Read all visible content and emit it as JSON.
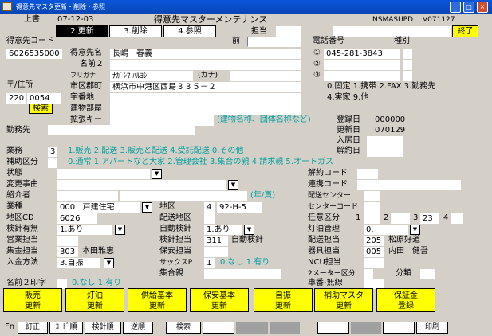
{
  "window": {
    "title": "得意先マスタ更新・削除・参照",
    "min": "_",
    "max": "□",
    "close": "×"
  },
  "header": {
    "joshu": "上書",
    "date": "07-12-03",
    "screen_title": "得意先マスターメンテナンス",
    "program": "NSMASUPD",
    "version": "V071127"
  },
  "tabs": [
    "2.更新",
    "3.削除",
    "4.参照"
  ],
  "tanto_label": "担当",
  "exit_button": "終了",
  "labels": {
    "customer_code": "得意先コード",
    "mae": "前",
    "customer_name": "得意先名",
    "name2": "名前２",
    "furigana": "フリガナ",
    "kana": "(カナ)",
    "postal": "〒/住所",
    "city": "市区郡町",
    "aza": "字番地",
    "building": "建物部屋",
    "ext_key": "拡張キー",
    "ext_hint": "(建物名称、団体名称など)",
    "phone": "電話番号",
    "shubetsu": "種別",
    "c1": "①",
    "c2": "②",
    "c3": "③",
    "phone_types1": "0.固定 1.携帯 2.FAX 3.勤務先",
    "phone_types2": "4.実家 9.他",
    "kinmusaki": "勤務先",
    "toroku": "登録日",
    "koshin": "更新日",
    "nyukyo": "入居日",
    "kaiyaku": "解約日",
    "gyomu": "業務",
    "gyomu_opts": "1.販売 2.配送 3.販売と配送 4.受託配送 0.その他",
    "hojo": "補助区分",
    "hojo_opts": "0.通常 1.アパートなど大家 2.管理会社 3.集合の親 4.請求親 5.オートガス",
    "jotai": "状態",
    "henko": "変更事由",
    "shokai": "紹介者",
    "nen": "(年/頁)",
    "kaiyaku_code": "解約コード",
    "renraku_code": "連携コード",
    "haiso_center": "配送センター",
    "center_code": "センターコード",
    "gyoshu": "業種",
    "chiku": "地区",
    "chiku_cd": "地区CD",
    "haiso_chiku": "配送地区",
    "nini": "任意区分",
    "kenshin": "検針有無",
    "jido": "自動検針",
    "toyu": "灯油管理",
    "eigyo": "営業担当",
    "kenshin_tanto": "検針担当",
    "haiso_tanto": "配送担当",
    "shukin": "集金担当",
    "hoan": "保安担当",
    "kigu": "器具担当",
    "nyukin": "入金方法",
    "sacks": "サックスP",
    "sacks_opts": "0.なし 1.有り",
    "ncu": "NCU担当",
    "shugo": "集合親",
    "meter": "2メーター区分",
    "bunrui": "分類",
    "name2_print": "名前２印字",
    "name2_opts": "0.なし 1.有り",
    "car": "車番-無線"
  },
  "values": {
    "customer_code": "6026535000",
    "customer_name": "長嶋　春義",
    "furigana": "ﾅｶﾞｼﾏ ﾊﾙﾖｼ",
    "postal1": "220",
    "postal2": "0054",
    "search": "検索",
    "city": "横浜市中港区西島３３５－２",
    "phone1": "045-281-3843",
    "toroku": "000000",
    "koshin": "070129",
    "gyomu": "3",
    "gyoshu_code": "000",
    "gyoshu_name": "戸建住宅",
    "chiku": "4",
    "chiku_name": "92-H-5",
    "chiku_cd": "6026",
    "kenshin": "1.あり",
    "jido": "1.あり",
    "kenshin_tanto_code": "311",
    "kenshin_tanto_name": "自動検針",
    "toyu": "0.",
    "nini1": "1",
    "nini2": "2",
    "nini3": "3",
    "nini3v": "23",
    "nini4": "4",
    "haiso_tanto_code": "205",
    "haiso_tanto_name": "松原好道",
    "shukin_code": "303",
    "shukin_name": "本田雅恵",
    "kigu_code": "005",
    "kigu_name": "内田　健吾",
    "nyukin": "3.自振",
    "sacks": "1"
  },
  "buttons": [
    {
      "l1": "販売",
      "l2": "更新"
    },
    {
      "l1": "灯油",
      "l2": "更新"
    },
    {
      "l1": "供給基本",
      "l2": "更新"
    },
    {
      "l1": "保安基本",
      "l2": "更新"
    },
    {
      "l1": "自振",
      "l2": "更新"
    },
    {
      "l1": "補助マスタ",
      "l2": "更新"
    },
    {
      "l1": "保証金",
      "l2": "登録"
    }
  ],
  "fkeys": {
    "fn": "Fn",
    "f1": "訂正",
    "f2": "ｺｰﾄﾞ順",
    "f3": "検針順",
    "f4": "逆順",
    "f5": "検索",
    "f12": "印刷"
  },
  "colors": {
    "cyan": "#00a0a0",
    "yellow": "#ffff00",
    "title_blue": "#0746b8"
  }
}
